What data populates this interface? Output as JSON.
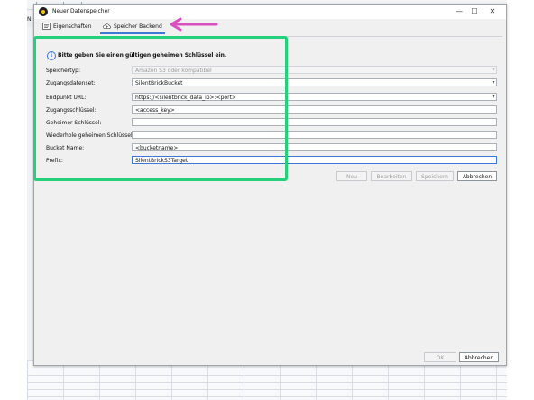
{
  "window": {
    "title": "Neuer Datenspeicher",
    "controls": {
      "minimize": "—",
      "maximize": "☐",
      "close": "✕"
    }
  },
  "tabs": [
    {
      "label": "Eigenschaften",
      "icon": "properties-icon",
      "active": false
    },
    {
      "label": "Speicher Backend",
      "icon": "cloud-upload-icon",
      "active": true
    }
  ],
  "notice": "Bitte geben Sie einen gültigen geheimen Schlüssel ein.",
  "form": {
    "storage_type": {
      "label": "Speichertyp:",
      "value": "Amazon S3 oder kompatibel"
    },
    "access_dataset": {
      "label": "Zugangsdatenset:",
      "value": "SilentBrickBucket"
    },
    "endpoint": {
      "label": "Endpunkt URL:",
      "value": "https://<silentbrick_data_ip>:<port>"
    },
    "access_key": {
      "label": "Zugangsschlüssel:",
      "value": "<access_key>"
    },
    "secret_key": {
      "label": "Geheimer Schlüssel:",
      "value": ""
    },
    "secret_key_repeat": {
      "label": "Wiederhole geheimen Schlüssel:",
      "value": ""
    },
    "bucket": {
      "label": "Bucket Name:",
      "value": "<bucketname>"
    },
    "prefix": {
      "label": "Prefix:",
      "value": "SilentBrickS3Target"
    }
  },
  "dataset_buttons": {
    "new": "Neu",
    "edit": "Bearbeiten",
    "save": "Speichern",
    "cancel": "Abbrechen"
  },
  "footer": {
    "ok": "OK",
    "cancel": "Abbrechen"
  },
  "background": {
    "left_text": "Ni"
  },
  "colors": {
    "accent": "#3c78d8",
    "highlight_box": "#25d07a",
    "arrow": "#d94fc0"
  }
}
